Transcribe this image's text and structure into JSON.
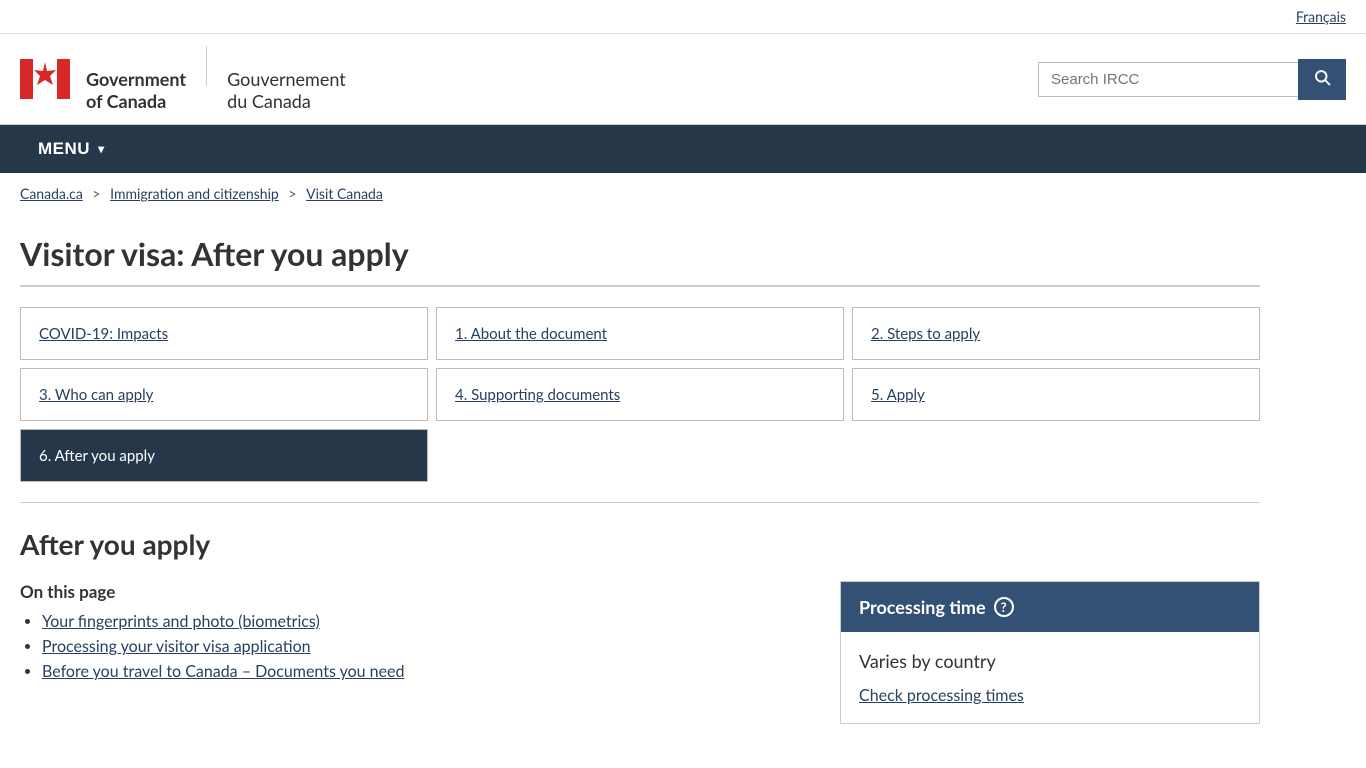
{
  "topbar": {
    "french_link": "Français"
  },
  "header": {
    "gov_name_en_line1": "Government",
    "gov_name_en_line2": "of Canada",
    "gov_name_fr_line1": "Gouvernement",
    "gov_name_fr_line2": "du Canada",
    "search_placeholder": "Search IRCC",
    "search_button_label": "🔍"
  },
  "nav": {
    "menu_label": "MENU"
  },
  "breadcrumb": {
    "items": [
      {
        "label": "Canada.ca",
        "href": "#"
      },
      {
        "label": "Immigration and citizenship",
        "href": "#"
      },
      {
        "label": "Visit Canada",
        "href": "#"
      }
    ]
  },
  "page": {
    "title": "Visitor visa: After you apply",
    "tabs": [
      {
        "id": "covid",
        "label": "COVID-19: Impacts",
        "active": false
      },
      {
        "id": "about",
        "label": "1. About the document",
        "active": false
      },
      {
        "id": "steps",
        "label": "2. Steps to apply",
        "active": false
      },
      {
        "id": "who",
        "label": "3. Who can apply",
        "active": false
      },
      {
        "id": "supporting",
        "label": "4. Supporting documents",
        "active": false
      },
      {
        "id": "apply",
        "label": "5. Apply",
        "active": false
      },
      {
        "id": "after",
        "label": "6. After you apply",
        "active": true
      }
    ],
    "section_heading": "After you apply",
    "on_this_page_label": "On this page",
    "toc": [
      {
        "label": "Your fingerprints and photo (biometrics)",
        "href": "#"
      },
      {
        "label": "Processing your visitor visa application",
        "href": "#"
      },
      {
        "label": "Before you travel to Canada – Documents you need",
        "href": "#"
      }
    ],
    "processing_time": {
      "heading": "Processing time",
      "info_icon": "?",
      "varies_text": "Varies by country",
      "check_link": "Check processing times"
    }
  }
}
